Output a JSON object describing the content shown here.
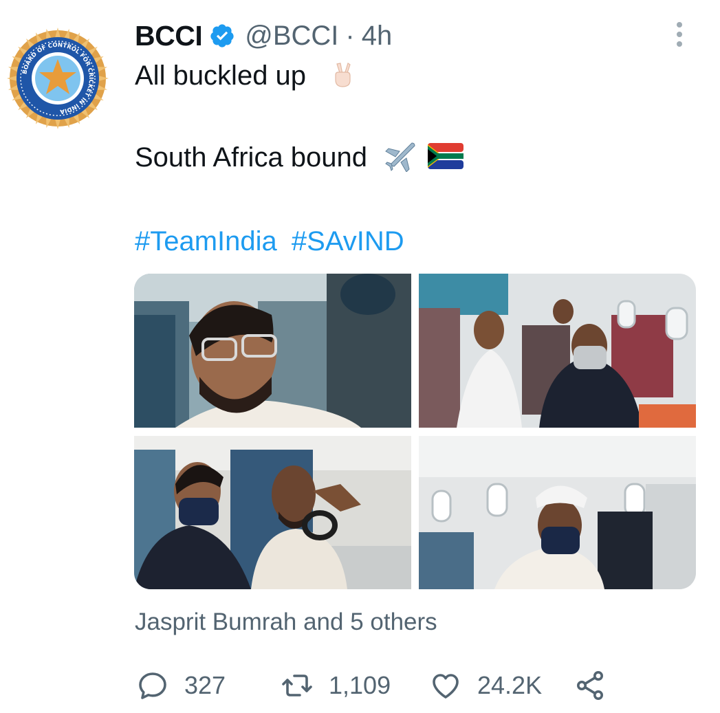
{
  "tweet": {
    "author": {
      "name": "BCCI",
      "handle": "@BCCI",
      "verified": true,
      "avatar_icon": "bcci-logo",
      "avatar_ring_text": "BOARD OF CONTROL FOR CRICKET IN INDIA"
    },
    "separator": "·",
    "time": "4h",
    "text_line1": "All buckled up",
    "text_line2": "South Africa bound",
    "hashtags": [
      "#TeamIndia",
      "#SAvIND"
    ],
    "tagged": "Jasprit Bumrah and 5 others",
    "stats": {
      "replies": "327",
      "retweets": "1,109",
      "likes": "24.2K"
    }
  },
  "colors": {
    "text": "#0f1419",
    "secondary": "#536471",
    "link": "#1d9bf0",
    "verified": "#1d9bf0"
  }
}
